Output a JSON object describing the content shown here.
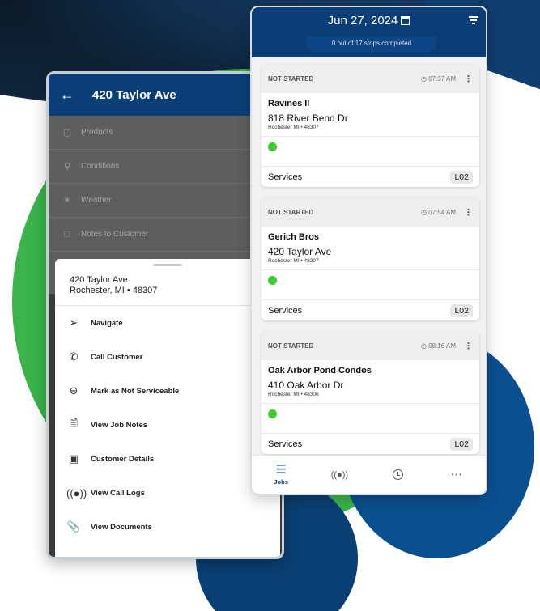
{
  "colors": {
    "brand": "#0b3e77",
    "green": "#39b34a",
    "status_dot": "#3ccc2f"
  },
  "left_phone": {
    "header": {
      "back_icon": "arrow-left-icon",
      "title": "420 Taylor Ave"
    },
    "rows": [
      {
        "icon": "box-icon",
        "label": "Products"
      },
      {
        "icon": "location-icon",
        "label": "Conditions"
      },
      {
        "icon": "weather-icon",
        "label": "Weather"
      },
      {
        "icon": "note-icon",
        "label": "Notes to Customer"
      }
    ],
    "sheet": {
      "address_line1": "420 Taylor Ave",
      "address_line2": "Rochester, MI • 48307",
      "items": [
        {
          "icon": "navigate-icon",
          "label": "Navigate"
        },
        {
          "icon": "phone-icon",
          "label": "Call Customer"
        },
        {
          "icon": "not-serviceable-icon",
          "label": "Mark as Not Serviceable"
        },
        {
          "icon": "document-icon",
          "label": "View Job Notes"
        },
        {
          "icon": "customer-icon",
          "label": "Customer Details"
        },
        {
          "icon": "call-log-icon",
          "label": "View Call Logs"
        },
        {
          "icon": "paperclip-icon",
          "label": "View Documents"
        }
      ]
    }
  },
  "right_phone": {
    "header": {
      "date": "Jun 27, 2024",
      "progress": "0 out of 17 stops completed"
    },
    "cards": [
      {
        "status": "NOT STARTED",
        "time": "07:37 AM",
        "name": "Ravines II",
        "street": "818 River Bend Dr",
        "city": "Rochester MI • 48307",
        "services_label": "Services",
        "code": "L02"
      },
      {
        "status": "NOT STARTED",
        "time": "07:54 AM",
        "name": "Gerich Bros",
        "street": "420 Taylor Ave",
        "city": "Rochester MI • 48307",
        "services_label": "Services",
        "code": "L02"
      },
      {
        "status": "NOT STARTED",
        "time": "08:16 AM",
        "name": "Oak Arbor Pond Condos",
        "street": "410 Oak Arbor Dr",
        "city": "Rochester MI • 48306",
        "services_label": "Services",
        "code": "L02"
      }
    ],
    "nav": [
      {
        "icon": "list-icon",
        "label": "Jobs"
      },
      {
        "icon": "call-icon",
        "label": ""
      },
      {
        "icon": "clock-icon",
        "label": ""
      },
      {
        "icon": "more-icon",
        "label": ""
      }
    ]
  }
}
